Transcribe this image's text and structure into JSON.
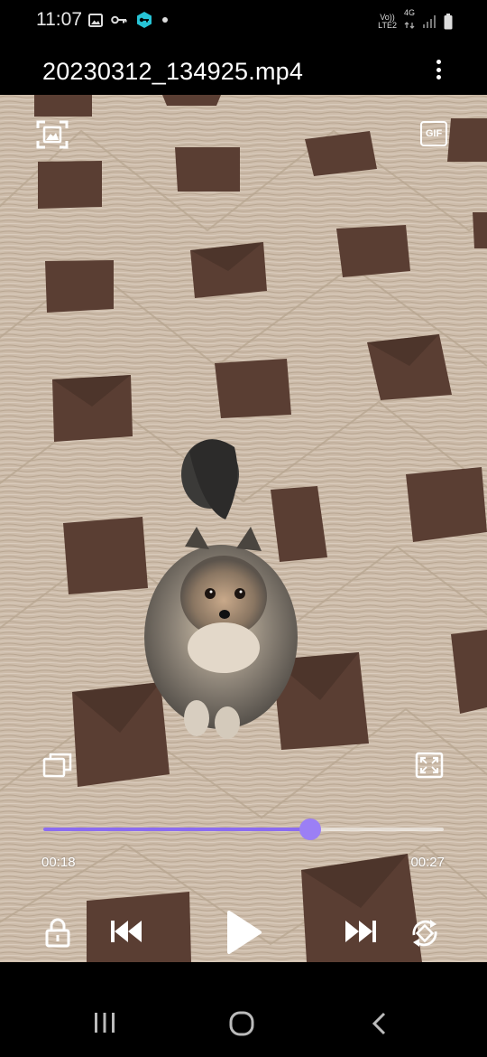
{
  "status_bar": {
    "time": "11:07",
    "network_top": "Vo))",
    "network_bottom": "LTE2",
    "signal_type": "4G"
  },
  "title_bar": {
    "file_name": "20230312_134925.mp4"
  },
  "player": {
    "gif_label": "GIF",
    "elapsed": "00:18",
    "duration": "00:27",
    "progress_fraction": 0.6667,
    "accent_color": "#8b6cf0"
  },
  "icons": {
    "capture": "capture-frame-icon",
    "gif": "gif-icon",
    "popup": "popup-view-icon",
    "fullscreen": "fullscreen-icon",
    "lock": "lock-icon",
    "previous": "skip-previous-icon",
    "play": "play-icon",
    "next": "skip-next-icon",
    "rotate": "rotate-icon"
  }
}
